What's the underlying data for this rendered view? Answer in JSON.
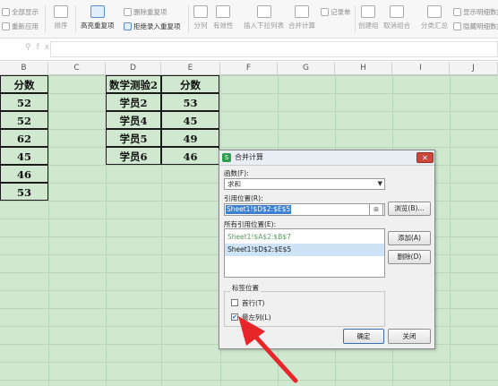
{
  "ribbon": {
    "show_all": "全部显示",
    "reapply": "重新应用",
    "sort": "排序",
    "highlight_dup": "高亮重复项",
    "remove_dup": "删除重复项",
    "reject_dup": "拒绝录入重复项",
    "split": "分列",
    "validation": "有效性",
    "dropdown": "插入下拉列表",
    "consolidate": "合并计算",
    "record": "记录单",
    "create_group": "创建组",
    "ungroup": "取消组合",
    "subtotal": "分类汇总",
    "show_detail": "显示明细数据",
    "hide_detail": "隐藏明细数据"
  },
  "formula_bar": {
    "fx": "fx",
    "value": ""
  },
  "columns": [
    "B",
    "C",
    "D",
    "E",
    "F",
    "G",
    "H",
    "I",
    "J"
  ],
  "sheet": {
    "b_header": "分数",
    "b_values": [
      "52",
      "52",
      "62",
      "45",
      "46",
      "53"
    ],
    "d_header": "数学测验2",
    "e_header": "分数",
    "d_values": [
      "学员2",
      "学员4",
      "学员5",
      "学员6"
    ],
    "e_values": [
      "53",
      "45",
      "49",
      "46"
    ]
  },
  "dialog": {
    "title": "合并计算",
    "close": "✕",
    "function_label": "函数(F):",
    "function_value": "求和",
    "ref_label": "引用位置(R):",
    "ref_value": "Sheet1!$D$2:$E$5",
    "browse": "浏览(B)...",
    "all_refs_label": "所有引用位置(E):",
    "all_refs": [
      "Sheet1!$A$2:$B$7",
      "Sheet1!$D$2:$E$5"
    ],
    "add": "添加(A)",
    "delete": "删除(D)",
    "labels_group": "标签位置",
    "first_row": "首行(T)",
    "first_row_checked": false,
    "left_col": "最左列(L)",
    "left_col_checked": true,
    "ok": "确定",
    "cancel": "关闭"
  },
  "annotation": {
    "arrow_color": "#e8262a"
  }
}
